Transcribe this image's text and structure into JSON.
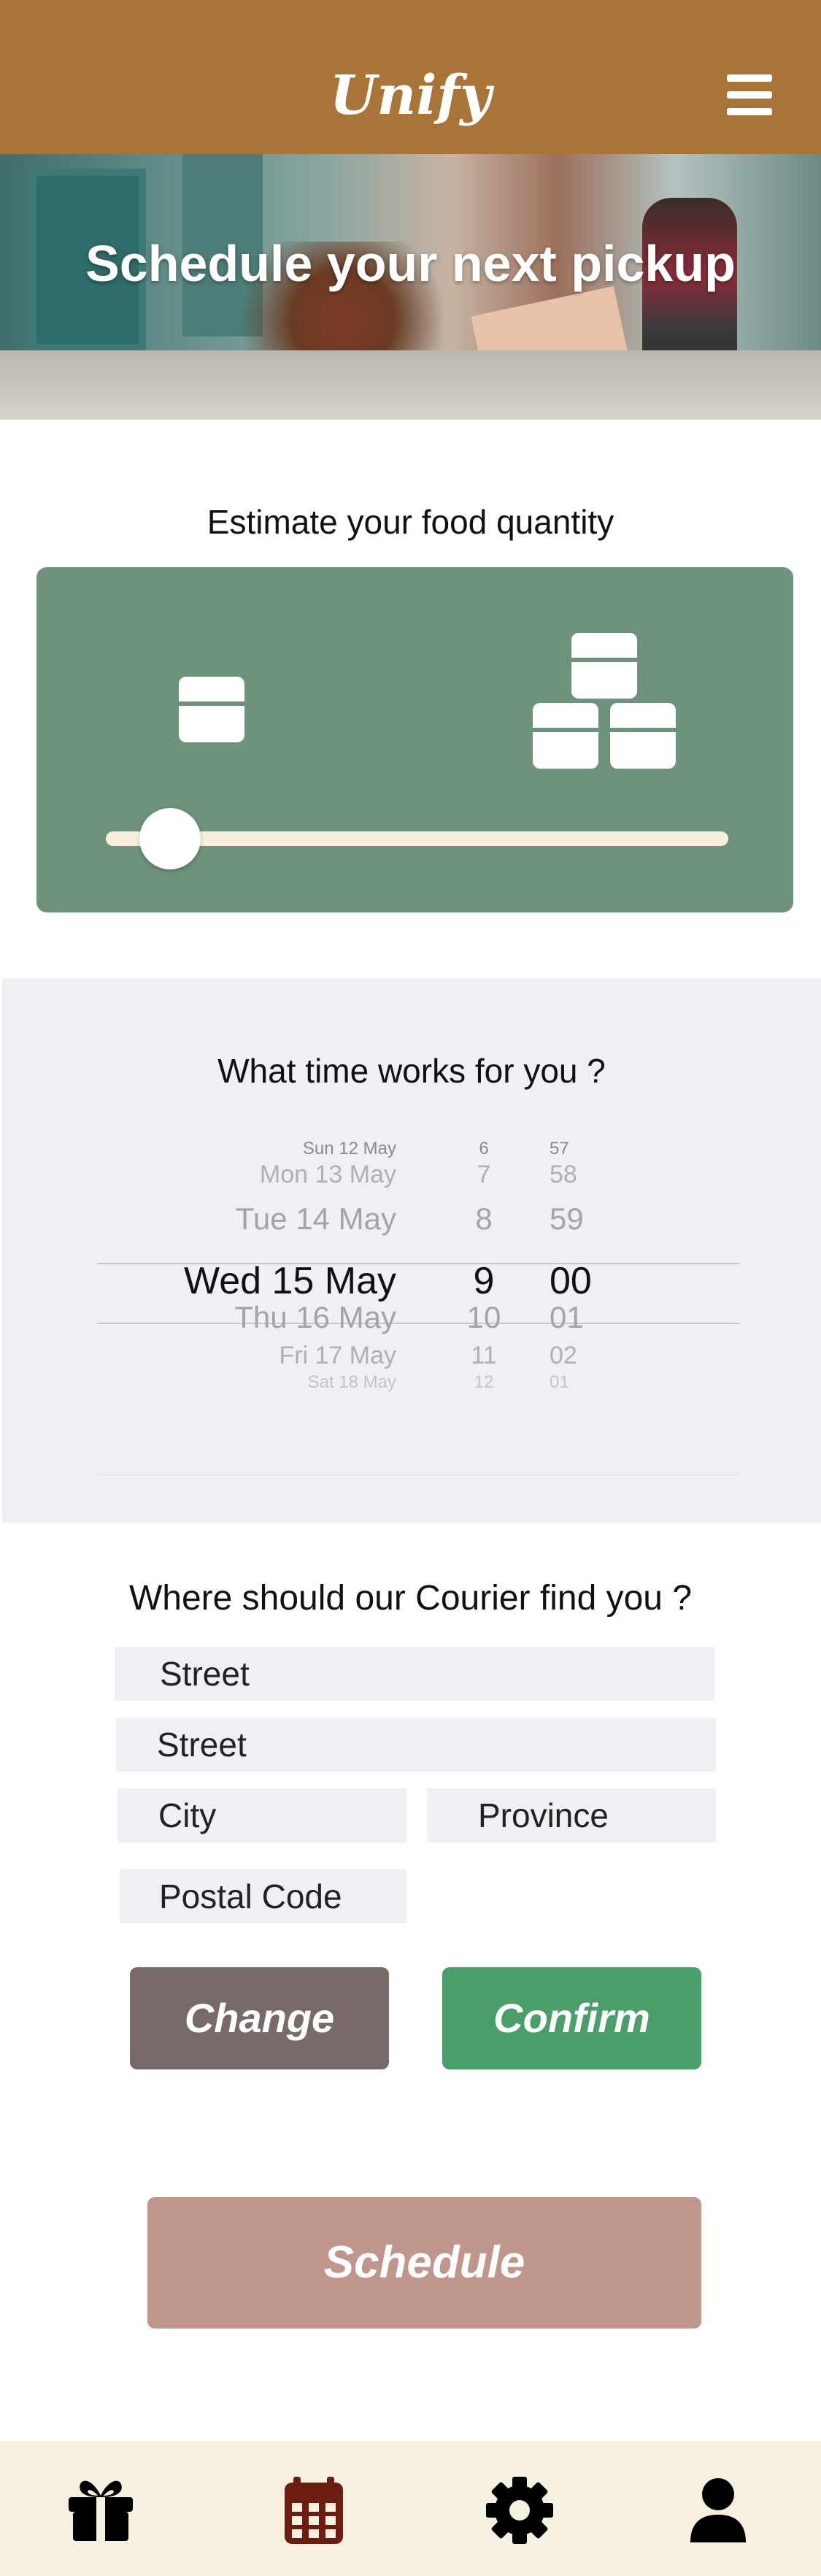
{
  "header": {
    "logo": "Unify",
    "menu_icon": "hamburger-menu-icon"
  },
  "hero": {
    "title": "Schedule your next pickup"
  },
  "quantity": {
    "title": "Estimate your food quantity",
    "icons": [
      "single-box-icon",
      "stacked-boxes-icon"
    ],
    "slider_value_fraction": 0.08,
    "colors": {
      "card": "#6e927b",
      "track": "#f5efdc"
    }
  },
  "time_picker": {
    "title": "What time works for you ?",
    "rows": [
      {
        "date": "Sun 12 May",
        "hour": "6",
        "minute": "57"
      },
      {
        "date": "Mon 13 May",
        "hour": "7",
        "minute": "58"
      },
      {
        "date": "Tue 14 May",
        "hour": "8",
        "minute": "59"
      },
      {
        "date": "Wed 15 May",
        "hour": "9",
        "minute": "00"
      },
      {
        "date": "Thu 16 May",
        "hour": "10",
        "minute": "01"
      },
      {
        "date": "Fri 17 May",
        "hour": "11",
        "minute": "02"
      },
      {
        "date": "Sat 18 May",
        "hour": "12",
        "minute": "01"
      }
    ],
    "selected": {
      "date": "Wed 15 May",
      "hour": "9",
      "minute": "00"
    }
  },
  "address": {
    "title": "Where should our Courier find you ?",
    "street1": "Street",
    "street2": "Street",
    "city": "City",
    "province": "Province",
    "postal_code": "Postal Code"
  },
  "buttons": {
    "change": "Change",
    "confirm": "Confirm",
    "schedule": "Schedule"
  },
  "bottom_nav": {
    "items": [
      "gift-icon",
      "calendar-icon",
      "gear-icon",
      "user-icon"
    ],
    "active": "calendar-icon",
    "colors": {
      "default": "#000000",
      "active": "#6b1d10"
    }
  }
}
